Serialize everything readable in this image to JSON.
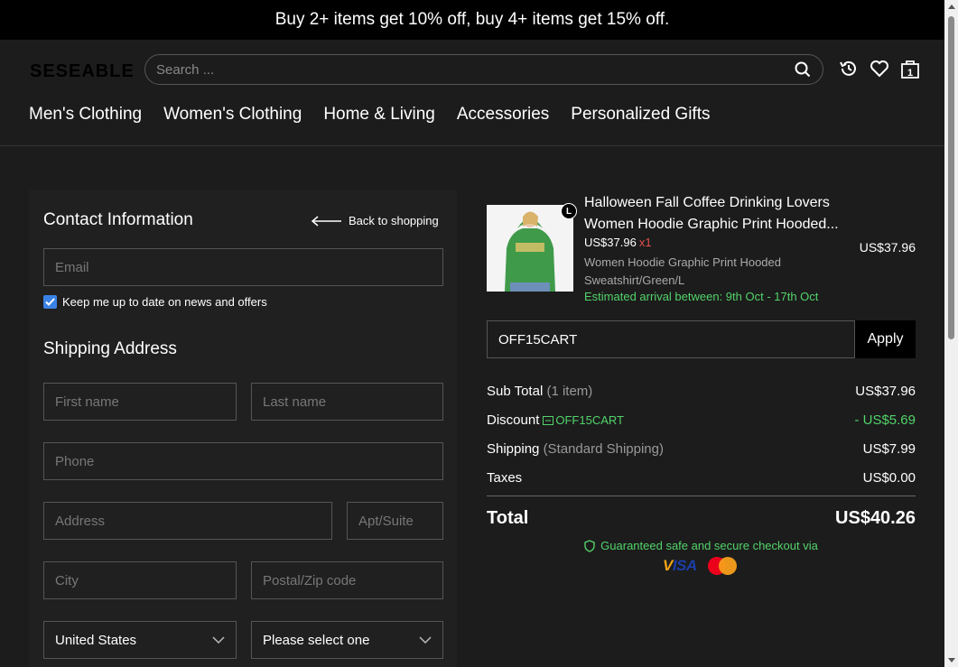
{
  "announcement": "Buy 2+ items get 10% off, buy 4+ items get 15% off.",
  "header": {
    "logo": "SESEABLE",
    "search_placeholder": "Search ...",
    "cart_count": "1"
  },
  "nav": [
    "Men's Clothing",
    "Women's Clothing",
    "Home & Living",
    "Accessories",
    "Personalized Gifts"
  ],
  "contact": {
    "title": "Contact Information",
    "back_label": "Back to shopping",
    "email_placeholder": "Email",
    "newsletter_label": "Keep me up to date on news and offers",
    "newsletter_checked": true
  },
  "shipping": {
    "title": "Shipping Address",
    "first_name_placeholder": "First name",
    "last_name_placeholder": "Last name",
    "phone_placeholder": "Phone",
    "address_placeholder": "Address",
    "apt_placeholder": "Apt/Suite",
    "city_placeholder": "City",
    "zip_placeholder": "Postal/Zip code",
    "country": "United States",
    "state": "Please select one"
  },
  "product": {
    "size_badge": "L",
    "title_line1": "Halloween Fall Coffee Drinking Lovers",
    "title_line2": "Women Hoodie Graphic Print Hooded...",
    "unit_price": "US$37.96",
    "qty": "x1",
    "variant": "Women Hoodie Graphic Print Hooded Sweatshirt/Green/L",
    "eta": "Estimated arrival between: 9th Oct - 17th Oct",
    "line_total": "US$37.96"
  },
  "coupon": {
    "value": "OFF15CART",
    "apply_label": "Apply"
  },
  "summary": {
    "subtotal_label": "Sub Total",
    "subtotal_note": "(1 item)",
    "subtotal": "US$37.96",
    "discount_label": "Discount",
    "discount_code": "OFF15CART",
    "discount": "- US$5.69",
    "shipping_label": "Shipping",
    "shipping_note": "(Standard Shipping)",
    "shipping": "US$7.99",
    "taxes_label": "Taxes",
    "taxes": "US$0.00",
    "total_label": "Total",
    "total": "US$40.26"
  },
  "secure_text": "Guaranteed safe and secure checkout via",
  "payment_icons": [
    "visa-icon",
    "mastercard-icon"
  ],
  "colors": {
    "accent_green": "#52d36a",
    "checkbox_blue": "#3b82e6",
    "qty_red": "#e05050"
  }
}
